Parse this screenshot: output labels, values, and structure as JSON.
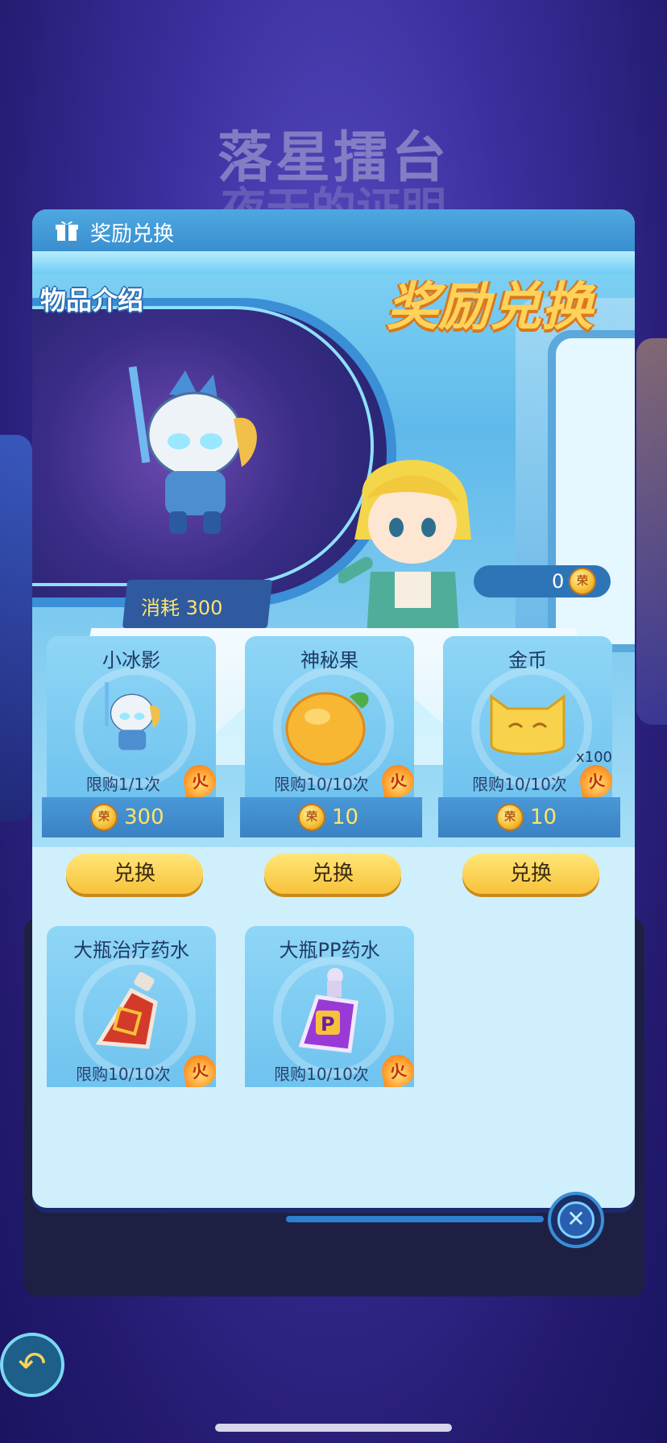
{
  "background": {
    "title": "落星擂台",
    "subtitle": "夜天的证明"
  },
  "panel": {
    "header_title": "奖励兑换",
    "intro_label": "物品介绍",
    "banner_title": "奖励兑换",
    "cost_text": "消耗 300",
    "balance": "0",
    "coin_glyph": "荣"
  },
  "items": [
    {
      "name": "小冰影",
      "limit": "限购1/1次",
      "price": "300",
      "button": "兑换",
      "fire": "火"
    },
    {
      "name": "神秘果",
      "limit": "限购10/10次",
      "price": "10",
      "button": "兑换",
      "fire": "火"
    },
    {
      "name": "金币",
      "limit": "限购10/10次",
      "price": "10",
      "button": "兑换",
      "fire": "火",
      "qty": "x100"
    },
    {
      "name": "大瓶治疗药水",
      "limit": "限购10/10次",
      "fire": "火"
    },
    {
      "name": "大瓶PP药水",
      "limit": "限购10/10次",
      "fire": "火"
    }
  ],
  "controls": {
    "close_glyph": "✕",
    "back_glyph": "↶"
  },
  "colors": {
    "accent": "#3a8fcf",
    "gold": "#f7c23a",
    "price_text": "#ffe46a"
  }
}
